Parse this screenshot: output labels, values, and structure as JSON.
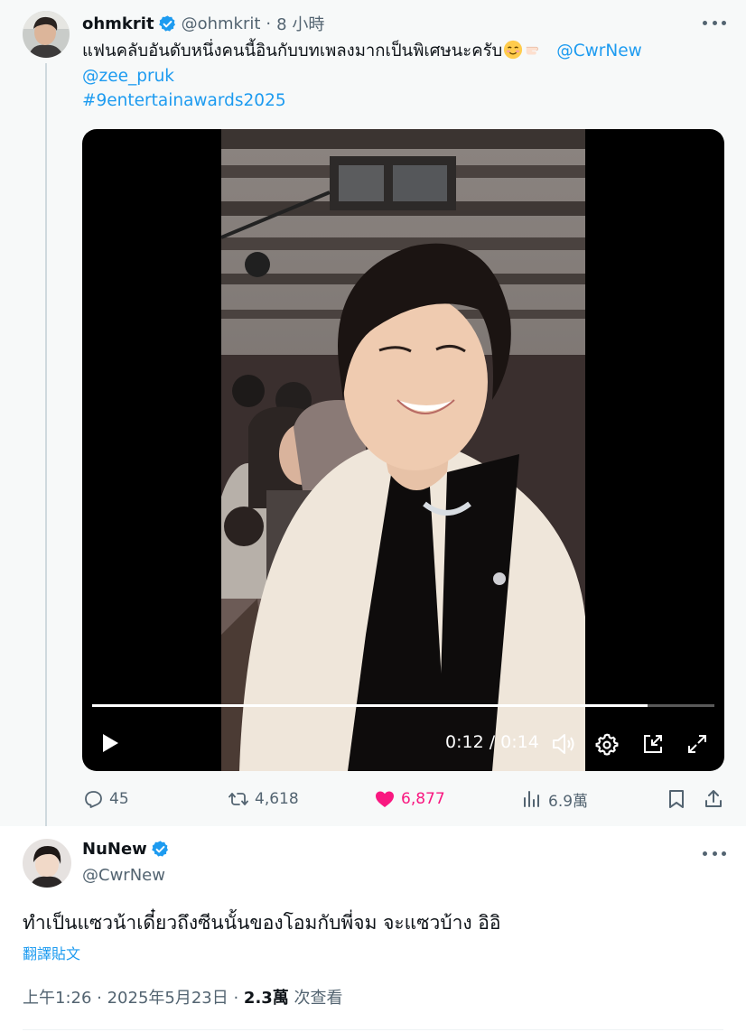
{
  "tweet": {
    "display_name": "ohmkrit",
    "handle": "@ohmkrit",
    "separator": "·",
    "time_ago": "8 小時",
    "text": "แฟนคลับอันดับหนึ่งคนนี้อินกับบทเพลงมากเป็นพิเศษนะครับ",
    "emojis": [
      "smiling-face-emoji",
      "pointing-hand-emoji"
    ],
    "mention_1": "@CwrNew",
    "mention_2": "@zee_pruk",
    "hashtag": "#9entertainawards2025",
    "video": {
      "current_time": "0:12",
      "duration": "0:14",
      "time_display": "0:12 / 0:14",
      "progress_fraction": 0.893
    },
    "stats": {
      "replies": "45",
      "reposts": "4,618",
      "likes": "6,877",
      "views": "6.9萬"
    }
  },
  "reply": {
    "display_name": "NuNew",
    "handle": "@CwrNew",
    "text": "ทำเป็นแซวน้าเดี๋ยวถึงซีนนั้นของโอมกับพี่จม จะแซวบ้าง อิอิ",
    "translate_label": "翻譯貼文",
    "timestamp": "上午1:26 · 2025年5月23日 · ",
    "views_count": "2.3萬",
    "views_label": " 次查看"
  },
  "colors": {
    "accent": "#1d9bf0",
    "like": "#f91880",
    "muted": "#536471",
    "thread_bg": "#f7f9f9"
  }
}
